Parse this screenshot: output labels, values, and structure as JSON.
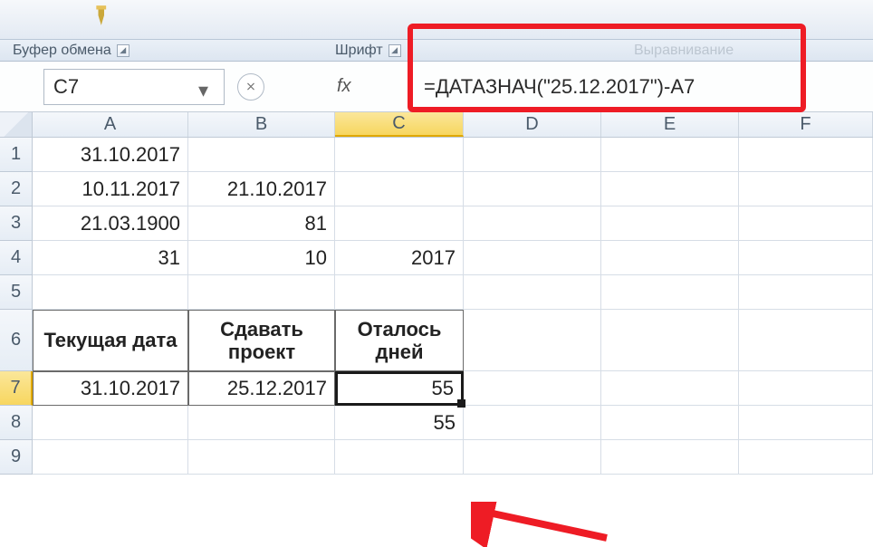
{
  "ribbon": {
    "group_clipboard": "Буфер обмена",
    "group_font": "Шрифт",
    "group_align": "Выравнивание"
  },
  "namebox": "C7",
  "fx_label": "fx",
  "formula": "=ДАТАЗНАЧ(\"25.12.2017\")-A7",
  "columns": [
    "A",
    "B",
    "C",
    "D",
    "E",
    "F"
  ],
  "rows": [
    "1",
    "2",
    "3",
    "4",
    "5",
    "6",
    "7",
    "8",
    "9"
  ],
  "cells": {
    "A1": "31.10.2017",
    "A2": "10.11.2017",
    "B2": "21.10.2017",
    "A3": "21.03.1900",
    "B3": "81",
    "A4": "31",
    "B4": "10",
    "C4": "2017",
    "A6": "Текущая дата",
    "B6": "Сдавать проект",
    "C6": "Оталось дней",
    "A7": "31.10.2017",
    "B7": "25.12.2017",
    "C7": "55",
    "C8": "55"
  }
}
